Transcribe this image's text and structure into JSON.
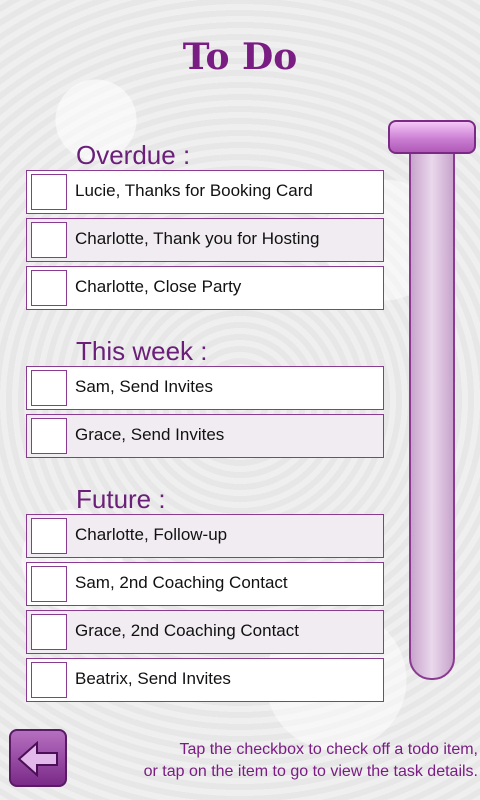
{
  "title": "To Do",
  "sections": [
    {
      "heading": "Overdue :",
      "items": [
        "Lucie, Thanks for Booking Card",
        "Charlotte, Thank you for Hosting",
        "Charlotte, Close Party"
      ]
    },
    {
      "heading": "This week :",
      "items": [
        "Sam, Send Invites",
        "Grace, Send Invites"
      ]
    },
    {
      "heading": "Future :",
      "items": [
        "Charlotte, Follow-up",
        "Sam, 2nd Coaching Contact",
        "Grace, 2nd Coaching Contact",
        "Beatrix, Send Invites"
      ]
    }
  ],
  "hint": {
    "line1": "Tap the checkbox to check off a todo item,",
    "line2": "or tap on the item to go to view the task details."
  },
  "icons": {
    "back": "back-arrow-icon"
  },
  "colors": {
    "accent": "#7a1d83"
  }
}
